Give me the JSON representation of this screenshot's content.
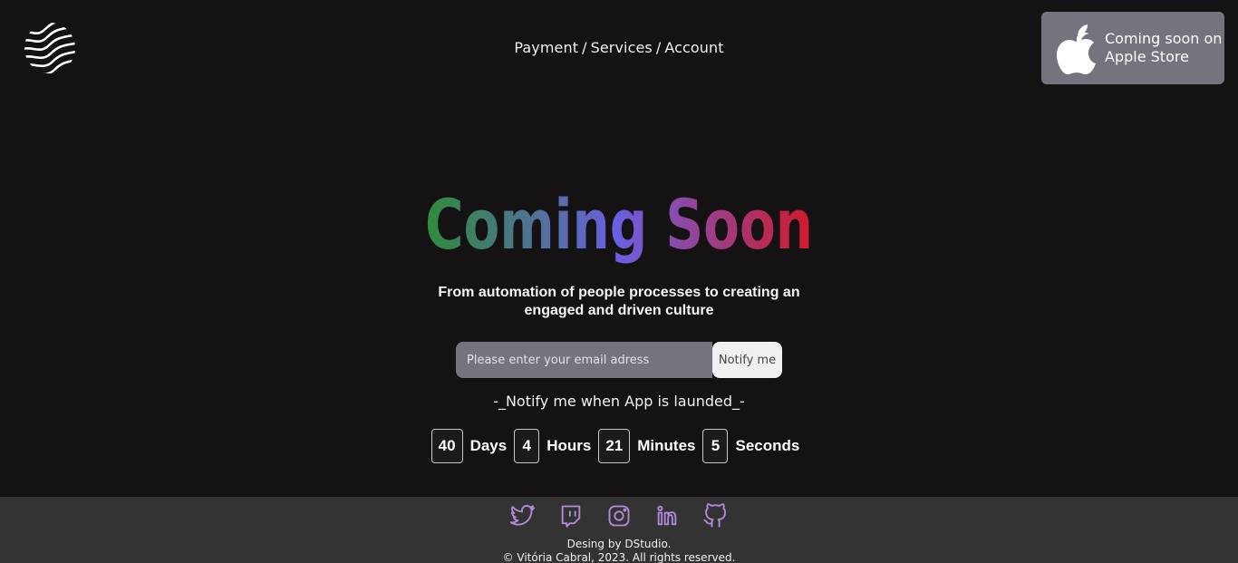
{
  "nav": {
    "items": [
      "Payment",
      "Services",
      "Account"
    ],
    "separator": "/"
  },
  "store_badge": {
    "line1": "Coming soon on",
    "line2": "Apple Store",
    "icon": "apple-icon"
  },
  "hero": {
    "title": "Coming Soon",
    "subtitle_line1": "From automation of people processes to creating an",
    "subtitle_line2": "engaged and driven culture"
  },
  "notify": {
    "placeholder": "Please enter your email adress",
    "value": "",
    "button_label": "Notify me",
    "note": "-_Notify me when App is launded_-"
  },
  "countdown": [
    {
      "value": "40",
      "label": "Days"
    },
    {
      "value": "4",
      "label": "Hours"
    },
    {
      "value": "21",
      "label": "Minutes"
    },
    {
      "value": "5",
      "label": "Seconds"
    }
  ],
  "footer": {
    "socials": [
      "twitter-icon",
      "twitch-icon",
      "instagram-icon",
      "linkedin-icon",
      "github-icon"
    ],
    "credit_line1": "Desing by DStudio.",
    "credit_line2": "© Vitória Cabral, 2023. All rights reserved."
  },
  "colors": {
    "background": "#141213",
    "footer": "#333333",
    "badge": "#77737e",
    "social_icon": "#b38ad9",
    "title_gradient": [
      "#2e8b3a",
      "#6b5fe0",
      "#d11a2a"
    ]
  }
}
